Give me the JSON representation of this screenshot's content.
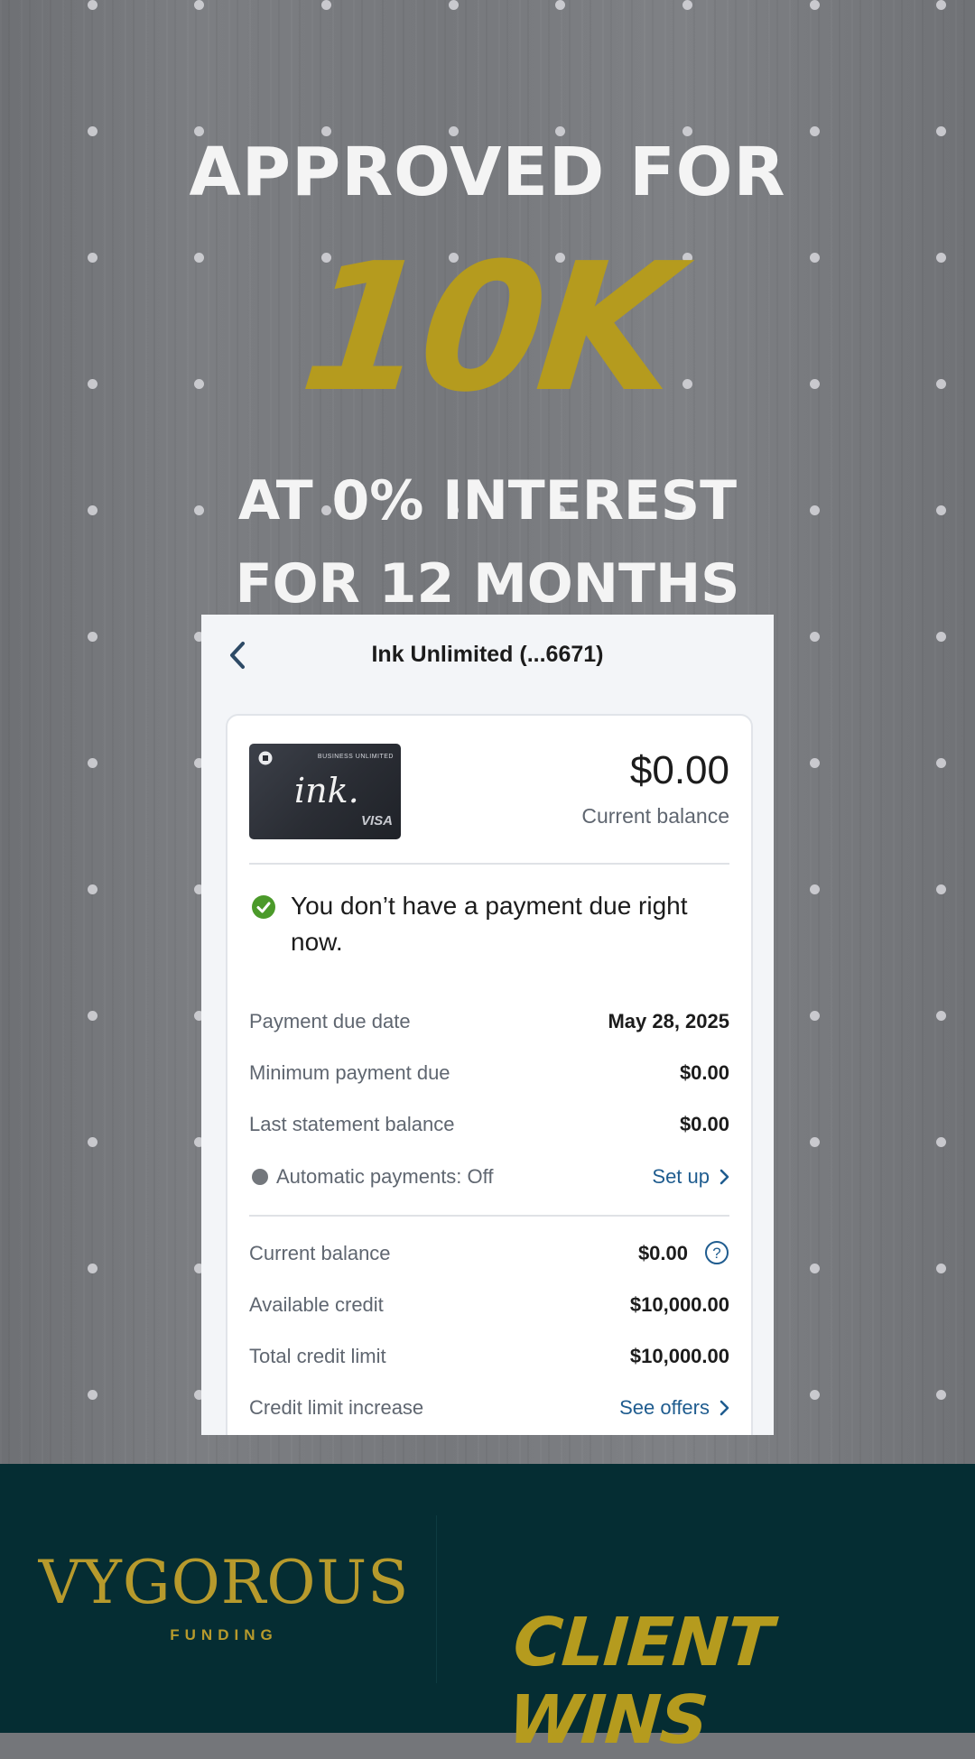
{
  "poster": {
    "headline_top": "APPROVED FOR",
    "headline_amount": "10K",
    "headline_rate_line1": "AT 0% INTEREST",
    "headline_rate_line2": "FOR 12 MONTHS",
    "accent_color": "#b59b1e"
  },
  "app": {
    "title": "Ink Unlimited (...6671)",
    "back_icon": "chevron-left-icon",
    "card_art": {
      "issuer_icon": "chase-octagon-icon",
      "product_text": "BUSINESS UNLIMITED",
      "script_text": "ink.",
      "network_text": "VISA"
    },
    "balance": {
      "amount": "$0.00",
      "label": "Current balance"
    },
    "status": {
      "icon": "check-circle-icon",
      "message": "You don’t have a payment due right now."
    },
    "payment_rows": [
      {
        "label": "Payment due date",
        "value": "May 28, 2025"
      },
      {
        "label": "Minimum payment due",
        "value": "$0.00"
      },
      {
        "label": "Last statement balance",
        "value": "$0.00"
      }
    ],
    "autopay": {
      "label": "Automatic payments: Off",
      "link": "Set up"
    },
    "credit_rows": [
      {
        "label": "Current balance",
        "value": "$0.00"
      },
      {
        "label": "Available credit",
        "value": "$10,000.00"
      },
      {
        "label": "Total credit limit",
        "value": "$10,000.00"
      }
    ],
    "credit_limit_increase": {
      "label": "Credit limit increase",
      "link": "See offers"
    },
    "link_color": "#1f5c8f",
    "success_color": "#4b9a2a"
  },
  "footer": {
    "brand_name": "VYGOROUS",
    "brand_sub": "FUNDING",
    "tagline": "CLIENT WINS",
    "background_color": "#052d33",
    "gold_color": "#b79a2c"
  }
}
